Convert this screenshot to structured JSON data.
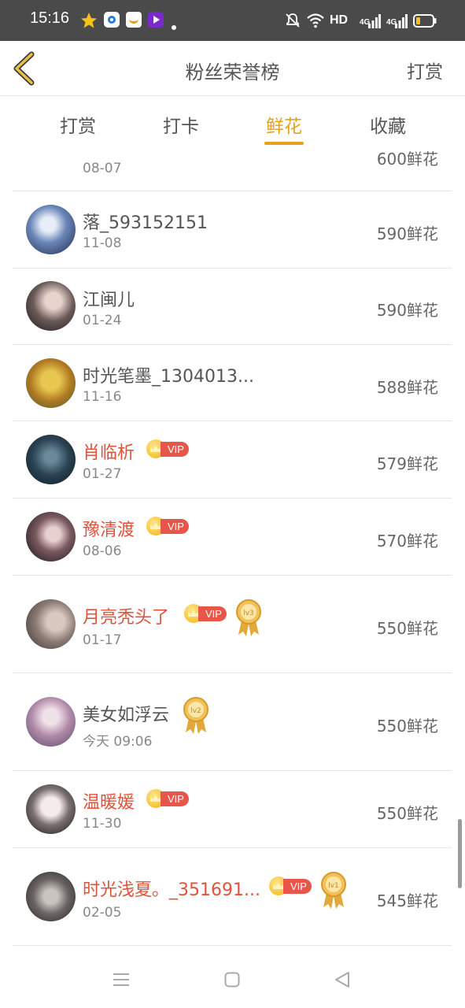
{
  "status_bar": {
    "time": "15:16",
    "network_label": "HD",
    "signal1_label": "4G",
    "signal2_label": "4G",
    "icons": [
      "star-icon",
      "app-icon",
      "app-icon",
      "app-icon",
      "mute-icon",
      "wifi-icon",
      "signal-icon",
      "battery-icon"
    ]
  },
  "header": {
    "title": "粉丝荣誉榜",
    "action_label": "打赏"
  },
  "tabs": [
    {
      "label": "打赏",
      "active": false
    },
    {
      "label": "打卡",
      "active": false
    },
    {
      "label": "鲜花",
      "active": true
    },
    {
      "label": "收藏",
      "active": false
    }
  ],
  "accent_color": "#e8a020",
  "vip_label": "VIP",
  "list": [
    {
      "name": "",
      "date": "08-07",
      "flowers": "600鲜花"
    },
    {
      "name": "落_593152151",
      "date": "11-08",
      "flowers": "590鲜花"
    },
    {
      "name": "江闽儿",
      "date": "01-24",
      "flowers": "590鲜花"
    },
    {
      "name": "时光笔墨_1304013...",
      "date": "11-16",
      "flowers": "588鲜花"
    },
    {
      "name": "肖临析",
      "date": "01-27",
      "flowers": "579鲜花",
      "vip": true
    },
    {
      "name": "豫清渡",
      "date": "08-06",
      "flowers": "570鲜花",
      "vip": true
    },
    {
      "name": "月亮秃头了",
      "date": "01-17",
      "flowers": "550鲜花",
      "vip": true,
      "medal": "lv3"
    },
    {
      "name": "美女如浮云",
      "date": "今天 09:06",
      "flowers": "550鲜花",
      "medal": "lv2"
    },
    {
      "name": "温暖媛",
      "date": "11-30",
      "flowers": "550鲜花",
      "vip": true
    },
    {
      "name": "时光浅夏。_351691...",
      "date": "02-05",
      "flowers": "545鲜花",
      "vip": true,
      "medal": "lv1"
    }
  ]
}
